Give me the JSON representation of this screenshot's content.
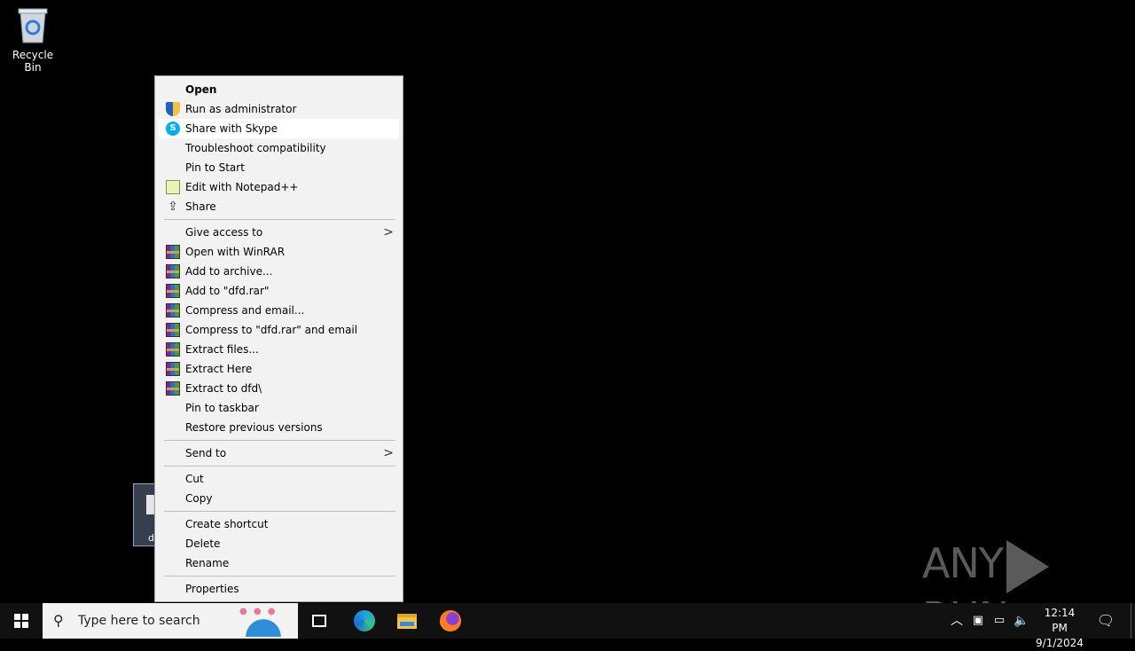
{
  "desktop": {
    "recycle_bin_label": "Recycle Bin",
    "file_label": "d"
  },
  "context_menu": {
    "items": [
      {
        "label": "Open",
        "icon": "",
        "bold": true
      },
      {
        "label": "Run as administrator",
        "icon": "uac-shield-icon"
      },
      {
        "label": "Share with Skype",
        "icon": "skype-icon",
        "highlighted": true
      },
      {
        "label": "Troubleshoot compatibility",
        "icon": ""
      },
      {
        "label": "Pin to Start",
        "icon": ""
      },
      {
        "label": "Edit with Notepad++",
        "icon": "notepadpp-icon"
      },
      {
        "label": "Share",
        "icon": "share-icon"
      },
      {
        "label": "Give access to",
        "icon": "",
        "submenu": true
      },
      {
        "label": "Open with WinRAR",
        "icon": "winrar-icon"
      },
      {
        "label": "Add to archive...",
        "icon": "winrar-icon"
      },
      {
        "label": "Add to \"dfd.rar\"",
        "icon": "winrar-icon"
      },
      {
        "label": "Compress and email...",
        "icon": "winrar-icon"
      },
      {
        "label": "Compress to \"dfd.rar\" and email",
        "icon": "winrar-icon"
      },
      {
        "label": "Extract files...",
        "icon": "winrar-icon"
      },
      {
        "label": "Extract Here",
        "icon": "winrar-icon"
      },
      {
        "label": "Extract to dfd\\",
        "icon": "winrar-icon"
      },
      {
        "label": "Pin to taskbar",
        "icon": ""
      },
      {
        "label": "Restore previous versions",
        "icon": ""
      },
      {
        "label": "Send to",
        "icon": "",
        "submenu": true
      },
      {
        "label": "Cut",
        "icon": ""
      },
      {
        "label": "Copy",
        "icon": ""
      },
      {
        "label": "Create shortcut",
        "icon": ""
      },
      {
        "label": "Delete",
        "icon": ""
      },
      {
        "label": "Rename",
        "icon": ""
      },
      {
        "label": "Properties",
        "icon": ""
      }
    ],
    "submenu_arrow": ">"
  },
  "watermark": {
    "left": "ANY",
    "right": "RUN"
  },
  "taskbar": {
    "search_placeholder": "Type here to search",
    "clock_time": "12:14 PM",
    "clock_date": "9/1/2024",
    "pinned": [
      "task-view-icon",
      "edge-icon",
      "file-explorer-icon",
      "firefox-icon"
    ]
  }
}
